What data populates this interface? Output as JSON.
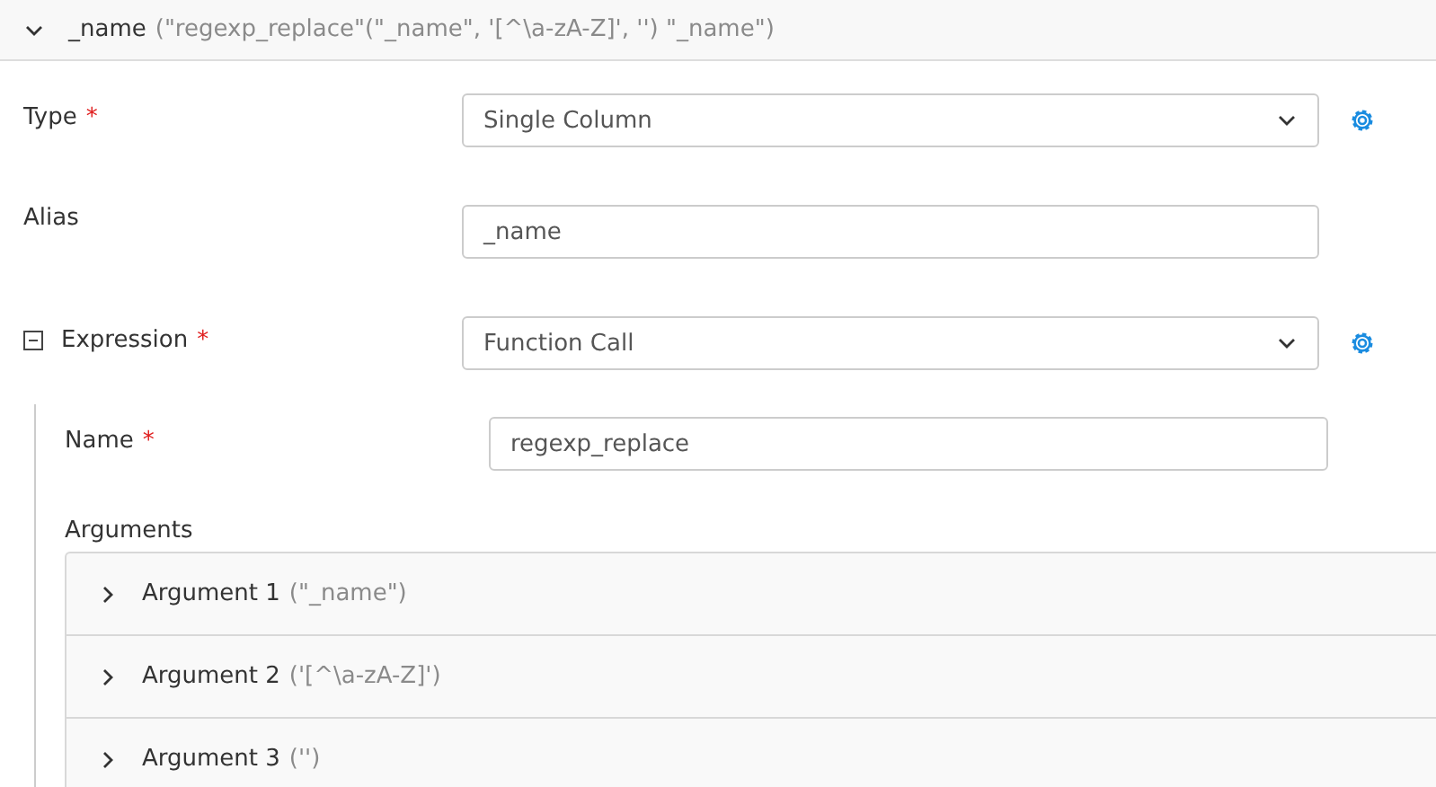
{
  "header": {
    "expanded": true,
    "name": "_name",
    "detail": "(\"regexp_replace\"(\"_name\", '[^\\a-zA-Z]', '') \"_name\")"
  },
  "fields": [
    {
      "kind": "select",
      "label": "Type",
      "required_mark": "*",
      "value": "Single Column",
      "settings": true
    },
    {
      "kind": "input",
      "label": "Alias",
      "value": "_name",
      "settings": false
    },
    {
      "kind": "select",
      "label": "Expression",
      "required_mark": "*",
      "value": "Function Call",
      "settings": true,
      "expanded": true
    }
  ],
  "function": {
    "name_label": "Name",
    "name_required_mark": "*",
    "name_value": "regexp_replace",
    "arguments_label": "Arguments",
    "arguments": [
      {
        "label": "Argument 1",
        "detail": "(\"_name\")",
        "expanded": false
      },
      {
        "label": "Argument 2",
        "detail": "('[^\\a-zA-Z]')",
        "expanded": false
      },
      {
        "label": "Argument 3",
        "detail": "('')",
        "expanded": false
      }
    ]
  }
}
